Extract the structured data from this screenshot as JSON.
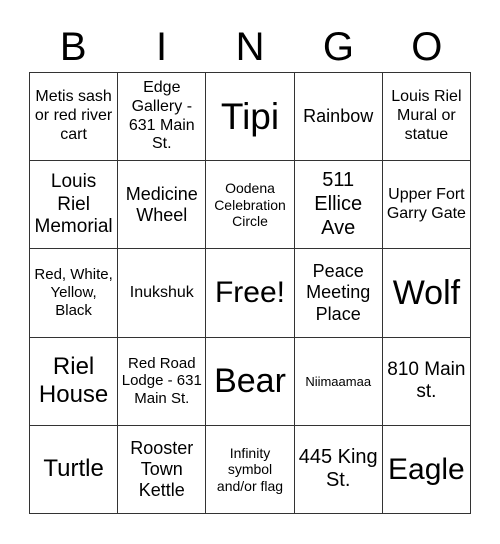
{
  "header": {
    "letters": [
      "B",
      "I",
      "N",
      "G",
      "O"
    ]
  },
  "grid": {
    "cells": [
      "Metis sash or red river cart",
      "Edge Gallery - 631 Main St.",
      "Tipi",
      "Rainbow",
      "Louis Riel Mural or statue",
      "Louis Riel Memorial",
      "Medicine Wheel",
      "Oodena Celebration Circle",
      "511 Ellice Ave",
      "Upper Fort Garry Gate",
      "Red, White, Yellow, Black",
      "Inukshuk",
      "Free!",
      "Peace Meeting Place",
      "Wolf",
      "Riel House",
      "Red Road Lodge - 631 Main St.",
      "Bear",
      "Niimaamaa",
      "810 Main st.",
      "Turtle",
      "Rooster Town Kettle",
      "Infinity symbol and/or flag",
      "445 King St.",
      "Eagle"
    ]
  }
}
